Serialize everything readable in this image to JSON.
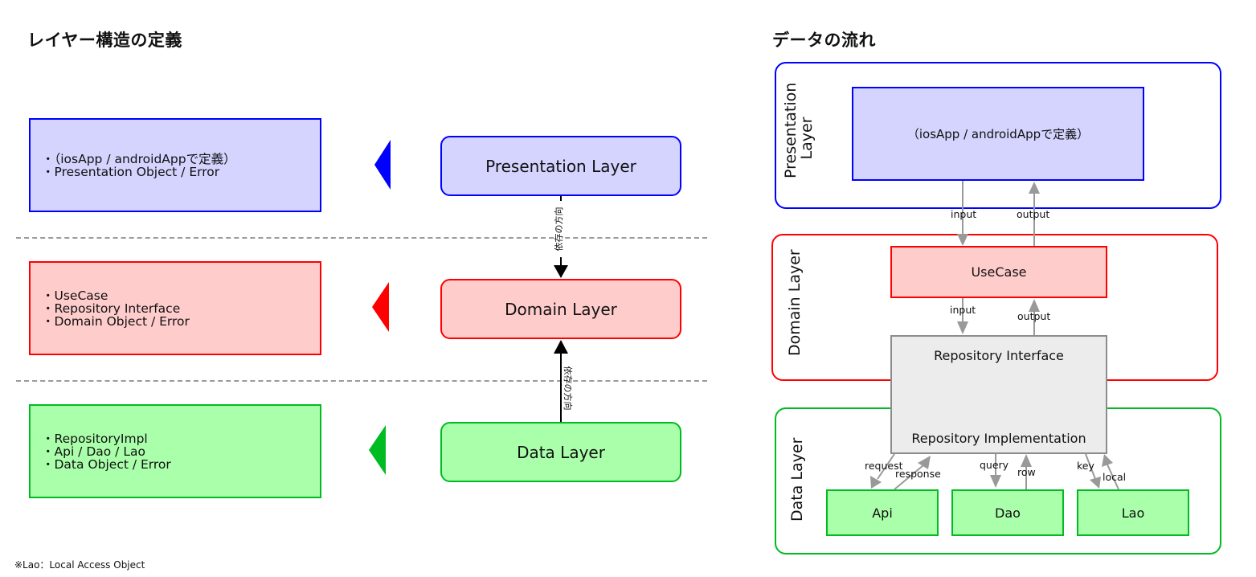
{
  "left": {
    "title": "レイヤー構造の定義",
    "dependency_label": "依存の方向",
    "footnote": "※Lao：Local Access Object",
    "layers": [
      {
        "name": "Presentation Layer",
        "items": [
          "・（iosApp / androidAppで定義）",
          "・Presentation Object / Error"
        ],
        "border": "#0000ff",
        "fill": "#d4d4ff"
      },
      {
        "name": "Domain Layer",
        "items": [
          "・UseCase",
          "・Repository Interface",
          "・Domain Object / Error"
        ],
        "border": "#ff0000",
        "fill": "#ffcccc"
      },
      {
        "name": "Data Layer",
        "items": [
          "・RepositoryImpl",
          "・Api / Dao / Lao",
          "・Data Object / Error"
        ],
        "border": "#00bb22",
        "fill": "#aaffaa"
      }
    ]
  },
  "right": {
    "title": "データの流れ",
    "panels": {
      "presentation": {
        "label": "Presentation Layer",
        "node": "（iosApp / androidAppで定義）"
      },
      "domain": {
        "label": "Domain Layer",
        "node": "UseCase"
      },
      "repository": {
        "interface": "Repository Interface",
        "implementation": "Repository Implementation"
      },
      "data": {
        "label": "Data Layer",
        "nodes": [
          "Api",
          "Dao",
          "Lao"
        ]
      }
    },
    "flows": {
      "pres_input": "input",
      "pres_output": "output",
      "uc_input": "input",
      "uc_output": "output",
      "api_request": "request",
      "api_response": "response",
      "dao_query": "query",
      "dao_row": "row",
      "lao_key": "key",
      "lao_local": "local"
    },
    "colors": {
      "blue": "#0000ff",
      "red": "#ff0000",
      "green": "#00bb22",
      "arrow_gray": "#999999",
      "repo_fill": "#ececec",
      "repo_border": "#8c8c8c"
    }
  }
}
